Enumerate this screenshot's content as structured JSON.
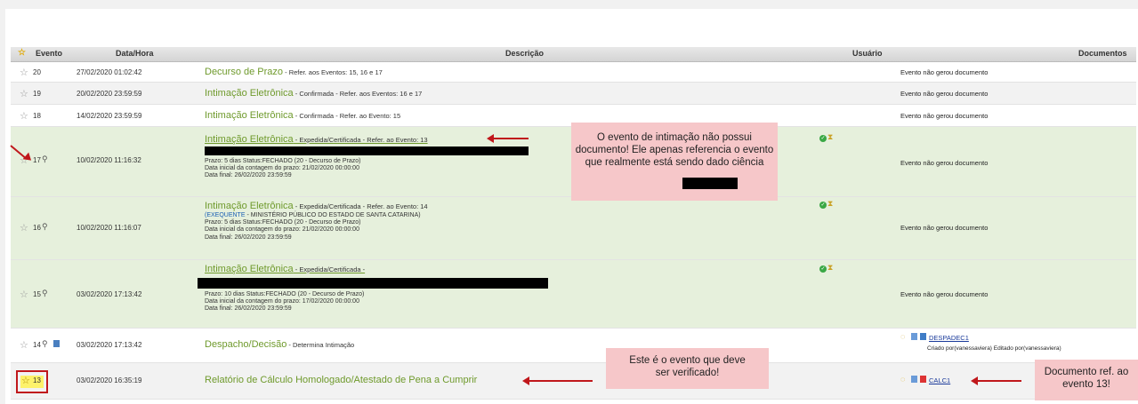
{
  "header": {
    "evento": "Evento",
    "datahora": "Data/Hora",
    "descricao": "Descrição",
    "usuario": "Usuário",
    "documentos": "Documentos"
  },
  "rows": [
    {
      "num": "20",
      "date": "27/02/2020 01:02:42",
      "title": "Decurso de Prazo",
      "sub": " - Refer. aos Eventos: 15, 16 e 17",
      "doc": "Evento não gerou documento"
    },
    {
      "num": "19",
      "date": "20/02/2020 23:59:59",
      "title": "Intimação Eletrônica",
      "sub": " - Confirmada - Refer. aos Eventos: 16 e 17",
      "doc": "Evento não gerou documento"
    },
    {
      "num": "18",
      "date": "14/02/2020 23:59:59",
      "title": "Intimação Eletrônica",
      "sub": " - Confirmada - Refer. ao Evento: 15",
      "doc": "Evento não gerou documento"
    },
    {
      "num": "17",
      "date": "10/02/2020 11:16:32",
      "title": "Intimação Eletrônica",
      "sub": " - Expedida/Certificada - Refer. ao Evento: 13",
      "lines": [
        "Prazo: 5 dias Status:FECHADO (20 - Decurso de Prazo)",
        "Data inicial da contagem do prazo: 21/02/2020 00:00:00",
        "Data final: 26/02/2020 23:59:59"
      ],
      "doc": "Evento não gerou documento"
    },
    {
      "num": "16",
      "date": "10/02/2020 11:16:07",
      "title": "Intimação Eletrônica",
      "sub": " - Expedida/Certificada - Refer. ao Evento: 14",
      "party": "(EXEQUENTE",
      "party_rest": " - MINISTÉRIO PÚBLICO DO ESTADO DE SANTA CATARINA)",
      "lines": [
        "Prazo: 5 dias Status:FECHADO (20 - Decurso de Prazo)",
        "Data inicial da contagem do prazo: 21/02/2020 00:00:00",
        "Data final: 26/02/2020 23:59:59"
      ],
      "doc": "Evento não gerou documento"
    },
    {
      "num": "15",
      "date": "03/02/2020 17:13:42",
      "title": "Intimação Eletrônica",
      "sub": " - Expedida/Certificada -",
      "lines": [
        "Prazo: 10 dias Status:FECHADO (20 - Decurso de Prazo)",
        "Data inicial da contagem do prazo: 17/02/2020 00:00:00",
        "Data final: 26/02/2020 23:59:59"
      ],
      "doc": "Evento não gerou documento"
    },
    {
      "num": "14",
      "date": "03/02/2020 17:13:42",
      "title": "Despacho/Decisão",
      "sub": " - Determina Intimação",
      "doclink": "DESPADEC1",
      "docnote": "Criado por(vanessaviera) Editado por(vanessaviera)"
    },
    {
      "num": "13",
      "date": "03/02/2020 16:35:19",
      "title": "Relatório de Cálculo Homologado/Atestado de Pena a Cumprir",
      "doclink": "CALC1"
    }
  ],
  "notes": {
    "n1": "O evento de intimação não possui documento! Ele apenas referencia o evento que realmente está sendo dado ciência",
    "n2": "Este é o evento que deve ser verificado!",
    "n3": "Documento ref. ao evento 13!"
  },
  "colors": {
    "title_green": "#6f9a2c",
    "row_green": "#e6f0dc",
    "note_pink": "#f6c7c9",
    "arrow_red": "#c0171b",
    "highlight_yellow": "#fdf26a"
  },
  "icons": [
    "star-icon",
    "magnifier-icon",
    "document-icon",
    "check-icon",
    "hourglass-icon",
    "lightbulb-icon",
    "pdf-icon"
  ]
}
